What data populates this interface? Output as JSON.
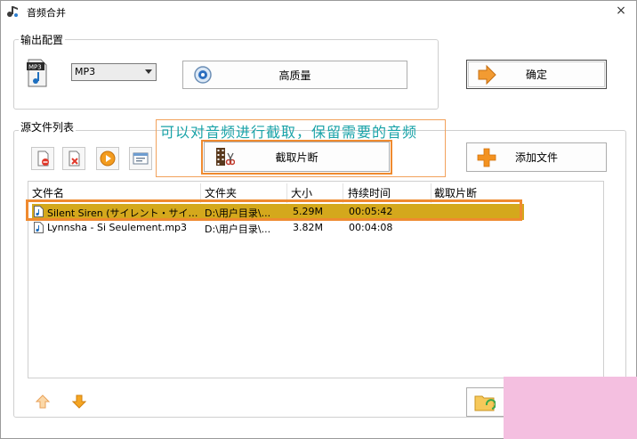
{
  "window": {
    "title": "音频合并",
    "close_glyph": "×"
  },
  "output_group": {
    "label": "输出配置",
    "format_icon_label": "MP3",
    "format_value": "MP3",
    "quality_button": "高质量",
    "confirm_button": "确定"
  },
  "source_group": {
    "label": "源文件列表",
    "cut_button": "截取片断",
    "add_button": "添加文件"
  },
  "annotation": {
    "text": "可以对音频进行截取，保留需要的音频"
  },
  "file_list": {
    "columns": [
      "文件名",
      "文件夹",
      "大小",
      "持续时间",
      "截取片断"
    ],
    "rows": [
      {
        "name": "Silent Siren (サイレント・サイ…",
        "folder": "D:\\用户目录\\...",
        "size": "5.29M",
        "duration": "00:05:42",
        "clip": ""
      },
      {
        "name": "Lynnsha - Si Seulement.mp3",
        "folder": "D:\\用户目录\\...",
        "size": "3.82M",
        "duration": "00:04:08",
        "clip": ""
      }
    ]
  },
  "colors": {
    "selection": "#d4a81c",
    "annotation_text": "#1aa3a8",
    "highlight_border": "#ef8a2f",
    "watermark_patch": "#f4bfe0"
  },
  "icons": {
    "title": "audio-merge-icon",
    "format": "mp3-file-icon",
    "quality": "settings-disc-icon",
    "confirm": "arrow-right-icon",
    "cut": "film-scissors-icon",
    "add": "plus-icon",
    "move_up": "arrow-up-icon",
    "move_down": "arrow-down-icon",
    "output_folder": "folder-icon"
  }
}
